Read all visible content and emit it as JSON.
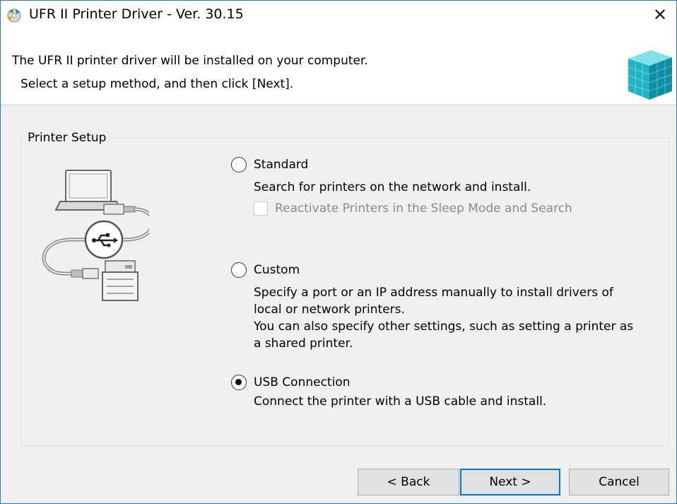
{
  "window": {
    "title": "UFR II Printer Driver - Ver. 30.15",
    "close_glyph": "✕"
  },
  "header": {
    "line1": "The UFR II printer driver will be installed on your computer.",
    "line2": "Select a setup method, and then click [Next]."
  },
  "group": {
    "label": "Printer Setup"
  },
  "options": [
    {
      "label": "Standard",
      "description": "Search for printers on the network and install.",
      "selected": false,
      "sub_checkbox": {
        "label": "Reactivate Printers in the Sleep Mode and Search",
        "checked": false,
        "enabled": false
      }
    },
    {
      "label": "Custom",
      "description": "Specify a port or an IP address manually to install drivers of local or network printers. You can also specify other settings, such as setting a printer as a shared printer.",
      "description_lines": [
        "Specify a port or an IP address manually to install drivers of",
        "local or network printers.",
        "You can also specify other settings, such as setting a printer as",
        "a shared printer."
      ],
      "selected": false
    },
    {
      "label": "USB Connection",
      "description": "Connect the printer with a USB cable and install.",
      "selected": true
    }
  ],
  "buttons": {
    "back": "< Back",
    "next": "Next >",
    "cancel": "Cancel"
  },
  "icons": {
    "app": "printer-driver-disc-icon",
    "header": "installer-cube-icon",
    "illustration": "usb-printer-connection-illustration"
  },
  "colors": {
    "window_border": "#2b79c7",
    "body_bg": "#f0f0f0",
    "default_button_border": "#0078d7",
    "button_bg": "#e1e1e1"
  }
}
